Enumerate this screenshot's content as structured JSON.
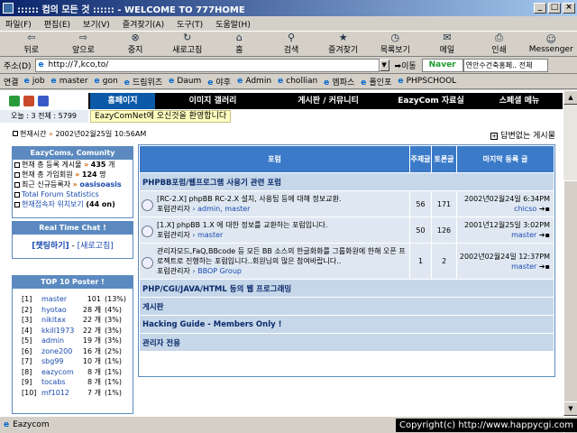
{
  "window": {
    "title": ":::::: 컴의 모든 것 :::::: - WELCOME TO 777HOME"
  },
  "menu": [
    "파일(F)",
    "편집(E)",
    "보기(V)",
    "즐겨찾기(A)",
    "도구(T)",
    "도움말(H)"
  ],
  "toolbar": [
    "뒤로",
    "앞으로",
    "중지",
    "새로고침",
    "홈",
    "검색",
    "즐겨찾기",
    "목록보기",
    "메일",
    "인쇄",
    "Messenger"
  ],
  "address": {
    "label": "주소(D)",
    "value": "http://7,kco,to/",
    "go": "이동",
    "naver": "Naver",
    "search_value": "연안수건축홍페.. 전체"
  },
  "links": {
    "label": "연결",
    "items": [
      "job",
      "master",
      "gon",
      "드림위즈",
      "Daum",
      "야후",
      "Admin",
      "chollian",
      "엠파스",
      "폴인포",
      "PHPSCHOOL"
    ]
  },
  "site": {
    "nav": [
      "홈페이지",
      "이미지 갤러리",
      "게시판 / 커뮤니티",
      "EazyCom 자료실",
      "스페셜 메뉴"
    ],
    "today": "오늘 : 3 전체 : 5799",
    "welcome": "EazyComNet에 오신것을 환영합니다",
    "time_label": "현재시간",
    "time_value": "2002년02월25일 10:56AM",
    "unread": "답변없는 게시물",
    "community": {
      "title": "EazyComs, Comunity",
      "rows": [
        {
          "label": "현재 총 등록 게시물",
          "value": "435",
          "unit": "개"
        },
        {
          "label": "현재 총 가입회원",
          "value": "124",
          "unit": "명"
        },
        {
          "label": "최근 신규등록자",
          "value": "oasisoasis",
          "unit": ""
        },
        {
          "label": "Total Forum Statistics",
          "value": "",
          "unit": ""
        },
        {
          "label": "현재접속자 위치보기",
          "value": "(44 on)",
          "unit": ""
        }
      ]
    },
    "chat": {
      "title": "Real Time Chat !",
      "link1": "[챗팅하기]",
      "sep": "-",
      "link2": "[새로고침]"
    },
    "top10": {
      "title": "TOP 10 Poster !",
      "rows": [
        {
          "rank": "[1]",
          "name": "master",
          "count": "101 개",
          "pct": "(13%)"
        },
        {
          "rank": "[2]",
          "name": "hyotao",
          "count": "28 개",
          "pct": "(4%)"
        },
        {
          "rank": "[3]",
          "name": "nikitax",
          "count": "22 개",
          "pct": "(3%)"
        },
        {
          "rank": "[4]",
          "name": "kkill1973",
          "count": "22 개",
          "pct": "(3%)"
        },
        {
          "rank": "[5]",
          "name": "admin",
          "count": "19 개",
          "pct": "(3%)"
        },
        {
          "rank": "[6]",
          "name": "zone200",
          "count": "16 개",
          "pct": "(2%)"
        },
        {
          "rank": "[7]",
          "name": "sbg99",
          "count": "10 개",
          "pct": "(1%)"
        },
        {
          "rank": "[8]",
          "name": "eazycom",
          "count": "8 개",
          "pct": "(1%)"
        },
        {
          "rank": "[9]",
          "name": "tocabs",
          "count": "8 개",
          "pct": "(1%)"
        },
        {
          "rank": "[10]",
          "name": "mf1012",
          "count": "7 개",
          "pct": "(1%)"
        }
      ]
    },
    "forum": {
      "headers": {
        "forum": "포럼",
        "topics": "주제글",
        "replies": "토론글",
        "last": "마지막 등록 글"
      },
      "moderator_label": "포럼관리자",
      "categories": [
        {
          "name": "PHPBB포럼/웹프로그램 사용기 관련 포럼",
          "forums": [
            {
              "desc": "[RC-2.X] phpBB RC-2.X 설치, 사용팁 등에 대해 정보교환.",
              "mods": "admin, master",
              "topics": "56",
              "replies": "171",
              "last_date": "2002년02월24일 6:34PM",
              "last_user": "chicso"
            },
            {
              "desc": "[1.X] phpBB 1.X 에 대한 정보를 교환하는 포럼입니다.",
              "mods": "master",
              "topics": "50",
              "replies": "126",
              "last_date": "2001년12월25일 3:02PM",
              "last_user": "master"
            },
            {
              "desc": "관리자모드,FaQ,BBcode 등 모든 BB 소스의 한글화화를 그룹화원에 한해 오픈 프로젝트로 진행하는 포럼입니다..회원님의 많은 참여바랍니다..",
              "mods": "BBOP Group",
              "topics": "1",
              "replies": "2",
              "last_date": "2002년02월24일 12:37PM",
              "last_user": "master"
            }
          ]
        },
        {
          "name": "PHP/CGI/JAVA/HTML 등의 웹 프로그래밍",
          "forums": []
        },
        {
          "name": "게시판",
          "forums": []
        },
        {
          "name": "Hacking Guide - Members Only !",
          "forums": []
        },
        {
          "name": "관리자 전용",
          "forums": []
        }
      ]
    }
  },
  "status": {
    "text": "Eazycom",
    "copyright": "Copyright(c) http://www.happycgi.com"
  }
}
